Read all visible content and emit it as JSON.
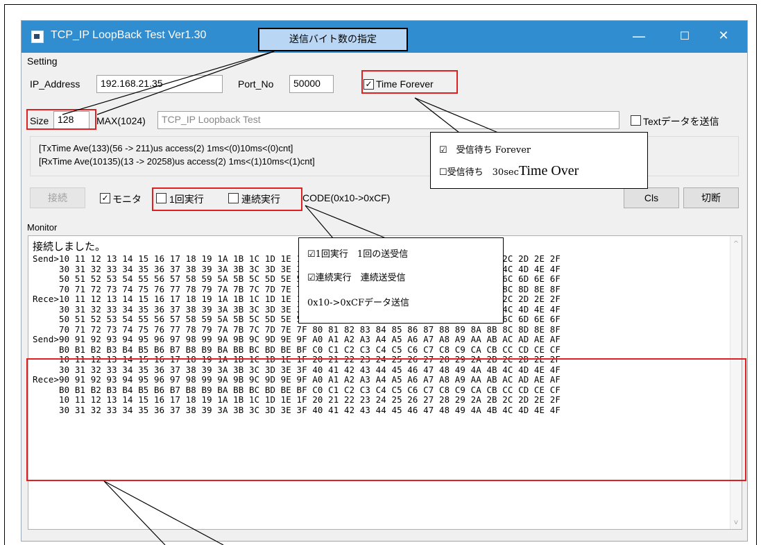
{
  "window": {
    "title": "TCP_IP LoopBack Test Ver1.30",
    "minimize": "—",
    "maximize": "☐",
    "close": "✕"
  },
  "setting": {
    "group_label": "Setting",
    "ip_label": "IP_Address",
    "ip_value": "192.168.21.35",
    "port_label": "Port_No",
    "port_value": "50000",
    "time_forever_label": "Time Forever",
    "size_label": "Size",
    "size_value": "128",
    "max_label": "MAX(1024)",
    "text_value": "TCP_IP Loopback Test",
    "text_send_label": "Textデータを送信"
  },
  "status": {
    "tx": "[TxTime Ave(133)(56 -> 211)us access(2) 1ms<(0)10ms<(0)cnt]",
    "rx": "[RxTime Ave(10135)(13 -> 20258)us access(2) 1ms<(1)10ms<(1)cnt]"
  },
  "controls": {
    "connect_label": "接続",
    "monitor_label": "モニタ",
    "once_label": "1回実行",
    "continuous_label": "連続実行",
    "code_label": "CODE(0x10->0xCF)",
    "cls_label": "Cls",
    "disconnect_label": "切断"
  },
  "monitor": {
    "label": "Monitor",
    "connected_msg": "接続しました。",
    "lines": [
      "Send>10 11 12 13 14 15 16 17 18 19 1A 1B 1C 1D 1E 1F 20 21 22 23 24 25 26 27 28 29 2A 2B 2C 2D 2E 2F",
      "     30 31 32 33 34 35 36 37 38 39 3A 3B 3C 3D 3E 3F 40 41 42 43 44 45 46 47 48 49 4A 4B 4C 4D 4E 4F",
      "     50 51 52 53 54 55 56 57 58 59 5A 5B 5C 5D 5E 5F 60 61 62 63 64 65 66 67 68 69 6A 6B 6C 6D 6E 6F",
      "     70 71 72 73 74 75 76 77 78 79 7A 7B 7C 7D 7E 7F 80 81 82 83 84 85 86 87 88 89 8A 8B 8C 8D 8E 8F",
      "Rece>10 11 12 13 14 15 16 17 18 19 1A 1B 1C 1D 1E 1F 20 21 22 23 24 25 26 27 28 29 2A 2B 2C 2D 2E 2F",
      "     30 31 32 33 34 35 36 37 38 39 3A 3B 3C 3D 3E 3F 40 41 42 43 44 45 46 47 48 49 4A 4B 4C 4D 4E 4F",
      "     50 51 52 53 54 55 56 57 58 59 5A 5B 5C 5D 5E 5F 60 61 62 63 64 65 66 67 68 69 6A 6B 6C 6D 6E 6F",
      "     70 71 72 73 74 75 76 77 78 79 7A 7B 7C 7D 7E 7F 80 81 82 83 84 85 86 87 88 89 8A 8B 8C 8D 8E 8F",
      "Send>90 91 92 93 94 95 96 97 98 99 9A 9B 9C 9D 9E 9F A0 A1 A2 A3 A4 A5 A6 A7 A8 A9 AA AB AC AD AE AF",
      "     B0 B1 B2 B3 B4 B5 B6 B7 B8 B9 BA BB BC BD BE BF C0 C1 C2 C3 C4 C5 C6 C7 C8 C9 CA CB CC CD CE CF",
      "     10 11 12 13 14 15 16 17 18 19 1A 1B 1C 1D 1E 1F 20 21 22 23 24 25 26 27 28 29 2A 2B 2C 2D 2E 2F",
      "     30 31 32 33 34 35 36 37 38 39 3A 3B 3C 3D 3E 3F 40 41 42 43 44 45 46 47 48 49 4A 4B 4C 4D 4E 4F",
      "Rece>90 91 92 93 94 95 96 97 98 99 9A 9B 9C 9D 9E 9F A0 A1 A2 A3 A4 A5 A6 A7 A8 A9 AA AB AC AD AE AF",
      "     B0 B1 B2 B3 B4 B5 B6 B7 B8 B9 BA BB BC BD BE BF C0 C1 C2 C3 C4 C5 C6 C7 C8 C9 CA CB CC CD CE CF",
      "     10 11 12 13 14 15 16 17 18 19 1A 1B 1C 1D 1E 1F 20 21 22 23 24 25 26 27 28 29 2A 2B 2C 2D 2E 2F",
      "     30 31 32 33 34 35 36 37 38 39 3A 3B 3C 3D 3E 3F 40 41 42 43 44 45 46 47 48 49 4A 4B 4C 4D 4E 4F"
    ]
  },
  "annotations": {
    "size_note": "送信バイト数の指定",
    "timeout_line1": "受信待ち Forever",
    "timeout_line2_prefix": "受信待ち　30sec",
    "timeout_line2_emph": "Time Over",
    "exec_line1": "1回実行　1回の送受信",
    "exec_line2": "連続実行　連続送受信",
    "exec_line3": "0x10->0xCFデータ送信"
  },
  "colors": {
    "titlebar": "#2f8dd0",
    "highlight_red": "#e02020",
    "note_blue": "#b9d6f4"
  }
}
